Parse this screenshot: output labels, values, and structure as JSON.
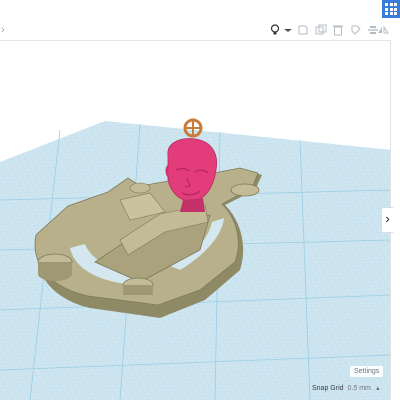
{
  "toolbar": {
    "icons": [
      "lightbulb-icon",
      "copy-icon",
      "duplicate-icon",
      "delete-icon",
      "group-icon",
      "align-icon",
      "mirror-icon"
    ],
    "back_arrow": "›"
  },
  "panel": {
    "toggle_glyph": "›"
  },
  "settings_label": "Settings",
  "snap_grid": {
    "label": "Snap Grid",
    "value": "0.5 mm",
    "caret": "▲"
  },
  "colors": {
    "grid_bg": "#cfe6f0",
    "grid_line": "#9bcde4",
    "model": "#b7b08a",
    "head": "#e23c7a",
    "ring": "#c97b3a",
    "accent": "#3a7cd6"
  }
}
